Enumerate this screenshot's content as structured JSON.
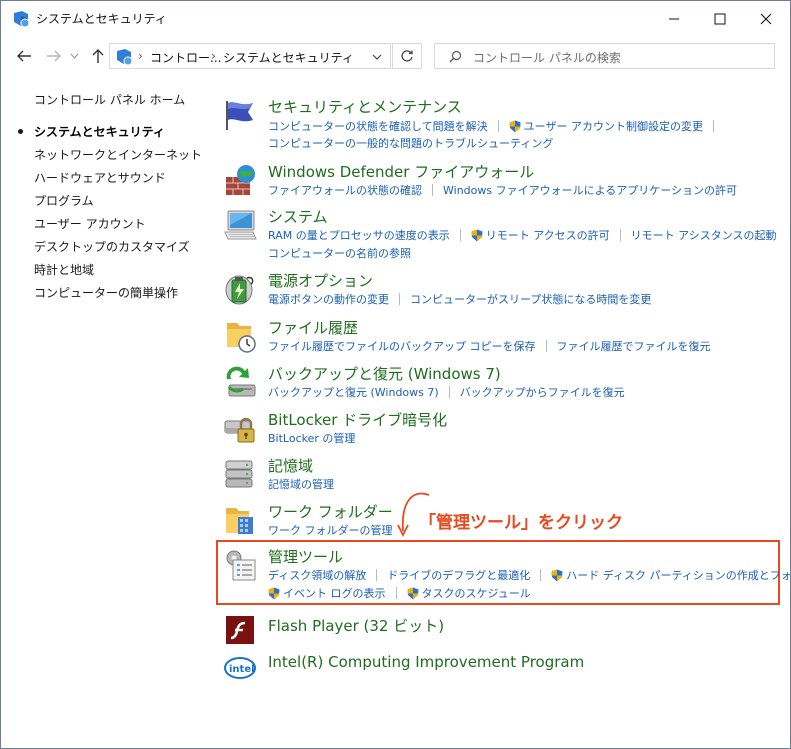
{
  "window": {
    "title": "システムとセキュリティ",
    "minimize": "—",
    "maximize": "☐",
    "close": "✕"
  },
  "address": {
    "crumbs": [
      "コントロー...",
      "システムとセキュリティ"
    ],
    "search_placeholder": "コントロール パネルの検索"
  },
  "sidebar": {
    "items": [
      {
        "label": "コントロール パネル ホーム"
      },
      {
        "label": "システムとセキュリティ"
      },
      {
        "label": "ネットワークとインターネット"
      },
      {
        "label": "ハードウェアとサウンド"
      },
      {
        "label": "プログラム"
      },
      {
        "label": "ユーザー アカウント"
      },
      {
        "label": "デスクトップのカスタマイズ"
      },
      {
        "label": "時計と地域"
      },
      {
        "label": "コンピューターの簡単操作"
      }
    ]
  },
  "categories": [
    {
      "title": "セキュリティとメンテナンス",
      "icon": "flag-icon",
      "rows": [
        [
          "コンピューターの状態を確認して問題を解決",
          "ユーザー アカウント制御設定の変更"
        ],
        [
          "コンピューターの一般的な問題のトラブルシューティング"
        ]
      ]
    },
    {
      "title": "Windows Defender ファイアウォール",
      "icon": "firewall-icon",
      "rows": [
        [
          "ファイアウォールの状態の確認",
          "Windows ファイアウォールによるアプリケーションの許可"
        ]
      ]
    },
    {
      "title": "システム",
      "icon": "computer-icon",
      "rows": [
        [
          "RAM の量とプロセッサの速度の表示",
          "リモート アクセスの許可",
          "リモート アシスタンスの起動"
        ],
        [
          "コンピューターの名前の参照"
        ]
      ]
    },
    {
      "title": "電源オプション",
      "icon": "battery-icon",
      "rows": [
        [
          "電源ボタンの動作の変更",
          "コンピューターがスリープ状態になる時間を変更"
        ]
      ]
    },
    {
      "title": "ファイル履歴",
      "icon": "file-history-icon",
      "rows": [
        [
          "ファイル履歴でファイルのバックアップ コピーを保存",
          "ファイル履歴でファイルを復元"
        ]
      ]
    },
    {
      "title": "バックアップと復元 (Windows 7)",
      "icon": "backup-icon",
      "rows": [
        [
          "バックアップと復元 (Windows 7)",
          "バックアップからファイルを復元"
        ]
      ]
    },
    {
      "title": "BitLocker ドライブ暗号化",
      "icon": "bitlocker-icon",
      "rows": [
        [
          "BitLocker の管理"
        ]
      ]
    },
    {
      "title": "記憶域",
      "icon": "storage-icon",
      "rows": [
        [
          "記憶域の管理"
        ]
      ]
    },
    {
      "title": "ワーク フォルダー",
      "icon": "work-folder-icon",
      "rows": [
        [
          "ワーク フォルダーの管理"
        ]
      ]
    },
    {
      "title": "管理ツール",
      "icon": "admin-tools-icon",
      "rows": [
        [
          "ディスク領域の解放",
          "ドライブのデフラグと最適化",
          "ハード ディスク パーティションの作成とフォーマット"
        ],
        [
          "イベント ログの表示",
          "タスクのスケジュール"
        ]
      ]
    },
    {
      "title": "Flash Player (32 ビット)",
      "icon": "flash-icon",
      "rows": []
    },
    {
      "title": "Intel(R) Computing Improvement Program",
      "icon": "intel-icon",
      "rows": []
    }
  ],
  "annotation": {
    "text": "「管理ツール」をクリック",
    "color": "#e64a1e"
  },
  "colors": {
    "title_green": "#1e6e1e",
    "link_blue": "#1a5fb4"
  }
}
